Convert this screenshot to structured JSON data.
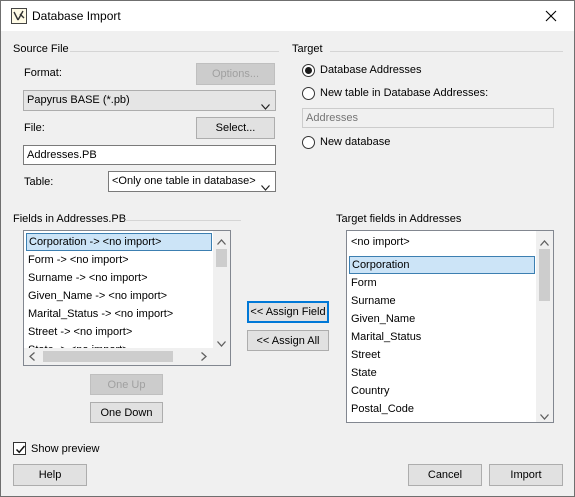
{
  "window": {
    "title": "Database Import"
  },
  "source": {
    "group_label": "Source File",
    "format_label": "Format:",
    "options_label": "Options...",
    "format_value": "Papyrus BASE (*.pb)",
    "file_label": "File:",
    "select_label": "Select...",
    "file_value": "Addresses.PB",
    "table_label": "Table:",
    "table_value": "<Only one table in database>"
  },
  "target": {
    "group_label": "Target",
    "options": [
      {
        "label": "Database Addresses",
        "checked": true
      },
      {
        "label": "New table in Database Addresses:",
        "checked": false
      },
      {
        "label": "New database",
        "checked": false
      }
    ],
    "new_table_placeholder": "Addresses"
  },
  "fields": {
    "label": "Fields in Addresses.PB",
    "items": [
      "Corporation -> <no import>",
      "Form -> <no import>",
      "Surname -> <no import>",
      "Given_Name -> <no import>",
      "Marital_Status -> <no import>",
      "Street -> <no import>",
      "State -> <no import>"
    ],
    "selected_index": 0
  },
  "target_fields": {
    "label": "Target fields in Addresses",
    "items": [
      "<no import>",
      "Corporation",
      "Form",
      "Surname",
      "Given_Name",
      "Marital_Status",
      "Street",
      "State",
      "Country",
      "Postal_Code"
    ],
    "selected_index": 1
  },
  "buttons": {
    "assign_field": "<< Assign Field",
    "assign_all": "<< Assign All",
    "one_up": "One Up",
    "one_down": "One Down",
    "help": "Help",
    "cancel": "Cancel",
    "import": "Import"
  },
  "show_preview": {
    "label": "Show preview",
    "checked": true
  },
  "icons": {
    "app": "app-icon",
    "close": "close-icon",
    "dropdown": "chevron-down-icon",
    "scroll_up": "scroll-up-arrow-icon",
    "scroll_down": "scroll-down-arrow-icon",
    "scroll_left": "scroll-left-arrow-icon",
    "scroll_right": "scroll-right-arrow-icon",
    "check": "check-icon"
  },
  "colors": {
    "accent": "#0078d7",
    "selection": "#cce4f7",
    "selection_border": "#3c7fb1"
  }
}
